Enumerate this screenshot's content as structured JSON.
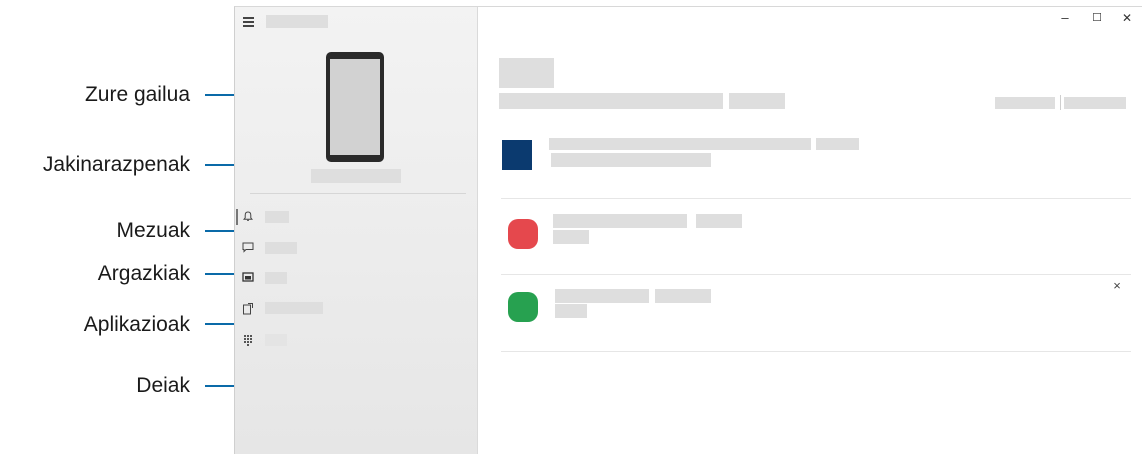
{
  "callouts": {
    "device": "Zure gailua",
    "notifications": "Jakinarazpenak",
    "messages": "Mezuak",
    "photos": "Argazkiak",
    "apps": "Aplikazioak",
    "calls": "Deiak"
  },
  "window": {
    "minimize": "–",
    "maximize": "☐",
    "close": "✕"
  },
  "nav_icons": {
    "notifications": "bell-icon",
    "messages": "message-icon",
    "photos": "photo-icon",
    "apps": "apps-icon",
    "calls": "dialpad-icon"
  },
  "notification_cards": [
    {
      "icon": "square",
      "color": "#0b3a6f"
    },
    {
      "icon": "round",
      "color": "#e5484d"
    },
    {
      "icon": "round",
      "color": "#27a150",
      "dismiss": "×"
    }
  ]
}
